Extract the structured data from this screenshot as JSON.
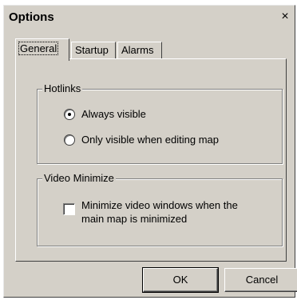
{
  "window": {
    "title": "Options",
    "close_glyph": "×"
  },
  "tabs": [
    {
      "label": "General",
      "active": true
    },
    {
      "label": "Startup",
      "active": false
    },
    {
      "label": "Alarms",
      "active": false
    }
  ],
  "hotlinks": {
    "legend": "Hotlinks",
    "options": [
      {
        "label": "Always visible",
        "checked": true
      },
      {
        "label": "Only visible when editing map",
        "checked": false
      }
    ]
  },
  "video_minimize": {
    "legend": "Video Minimize",
    "checkbox_label_line1": "Minimize video windows when the",
    "checkbox_label_line2": "main map is minimized",
    "checked": false
  },
  "buttons": {
    "ok": "OK",
    "cancel": "Cancel"
  }
}
